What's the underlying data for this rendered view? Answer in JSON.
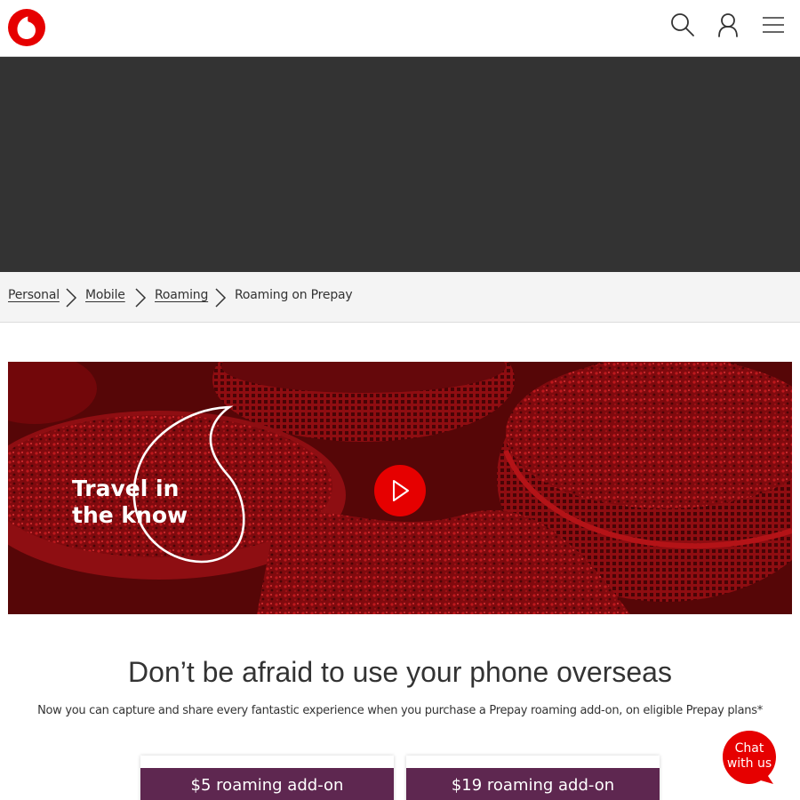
{
  "header": {
    "logo_icon": "vodafone-speechmark-logo",
    "icons": [
      "search-icon",
      "account-icon",
      "menu-icon"
    ],
    "brand_color": "#e60000"
  },
  "breadcrumb": {
    "items": [
      {
        "label": "Personal"
      },
      {
        "label": "Mobile"
      },
      {
        "label": "Roaming"
      },
      {
        "label": "Roaming on Prepay"
      }
    ]
  },
  "hero": {
    "title_line1": "Travel in",
    "title_line2": "the know",
    "play_icon": "play-icon"
  },
  "main": {
    "heading": "Don’t be afraid to use your phone overseas",
    "subtext": "Now you can capture and share every fantastic experience when you purchase a Prepay roaming add-on, on eligible Prepay plans*"
  },
  "cards": [
    {
      "title": "$5 roaming add-on"
    },
    {
      "title": "$19 roaming add-on"
    }
  ],
  "chat": {
    "line1": "Chat",
    "line2": "with us",
    "color": "#e60000"
  },
  "colors": {
    "card_header": "#5e2750",
    "banner": "#333333",
    "breadcrumb_bg": "#f4f4f4"
  }
}
